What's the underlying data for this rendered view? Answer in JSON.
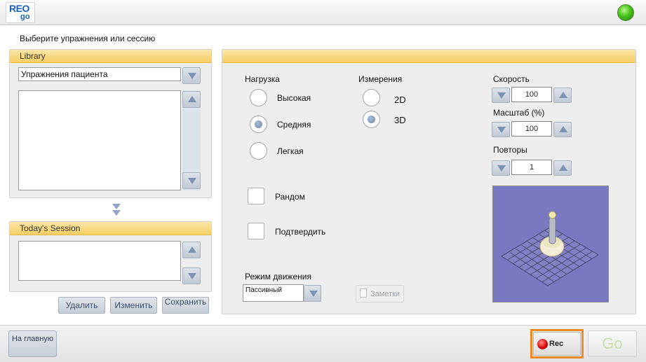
{
  "app": {
    "logo_text_top": "REO",
    "logo_text_bottom": "go"
  },
  "instruction": "Выберите упражнения или сессию",
  "library": {
    "title": "Library",
    "selected": "Упражнения пациента",
    "items": []
  },
  "session": {
    "title": "Today's Session",
    "items": []
  },
  "session_actions": {
    "delete": "Удалить",
    "edit": "Изменить",
    "save": "Сохранить"
  },
  "load": {
    "label": "Нагрузка",
    "options": [
      "Высокая",
      "Средняя",
      "Легкая"
    ],
    "selected": "Средняя"
  },
  "dimension": {
    "label": "Измерения",
    "options": [
      "2D",
      "3D"
    ],
    "selected": "3D"
  },
  "checkboxes": {
    "random": "Рандом",
    "confirm": "Подтвердить"
  },
  "motion_mode": {
    "label": "Режим движения",
    "value": "Пассивный"
  },
  "notes_button": "Заметки",
  "speed": {
    "label": "Скорость",
    "value": "100"
  },
  "scale": {
    "label": "Масштаб (%)",
    "value": "100"
  },
  "repeats": {
    "label": "Повторы",
    "value": "1"
  },
  "bottom": {
    "home": "На главную",
    "rec": "Rec",
    "go": "Go"
  },
  "colors": {
    "status_led": "#46c21a",
    "panel_header": "#f6cf63",
    "preview_bg": "#7a78c0",
    "rec_highlight": "#f08a24"
  }
}
